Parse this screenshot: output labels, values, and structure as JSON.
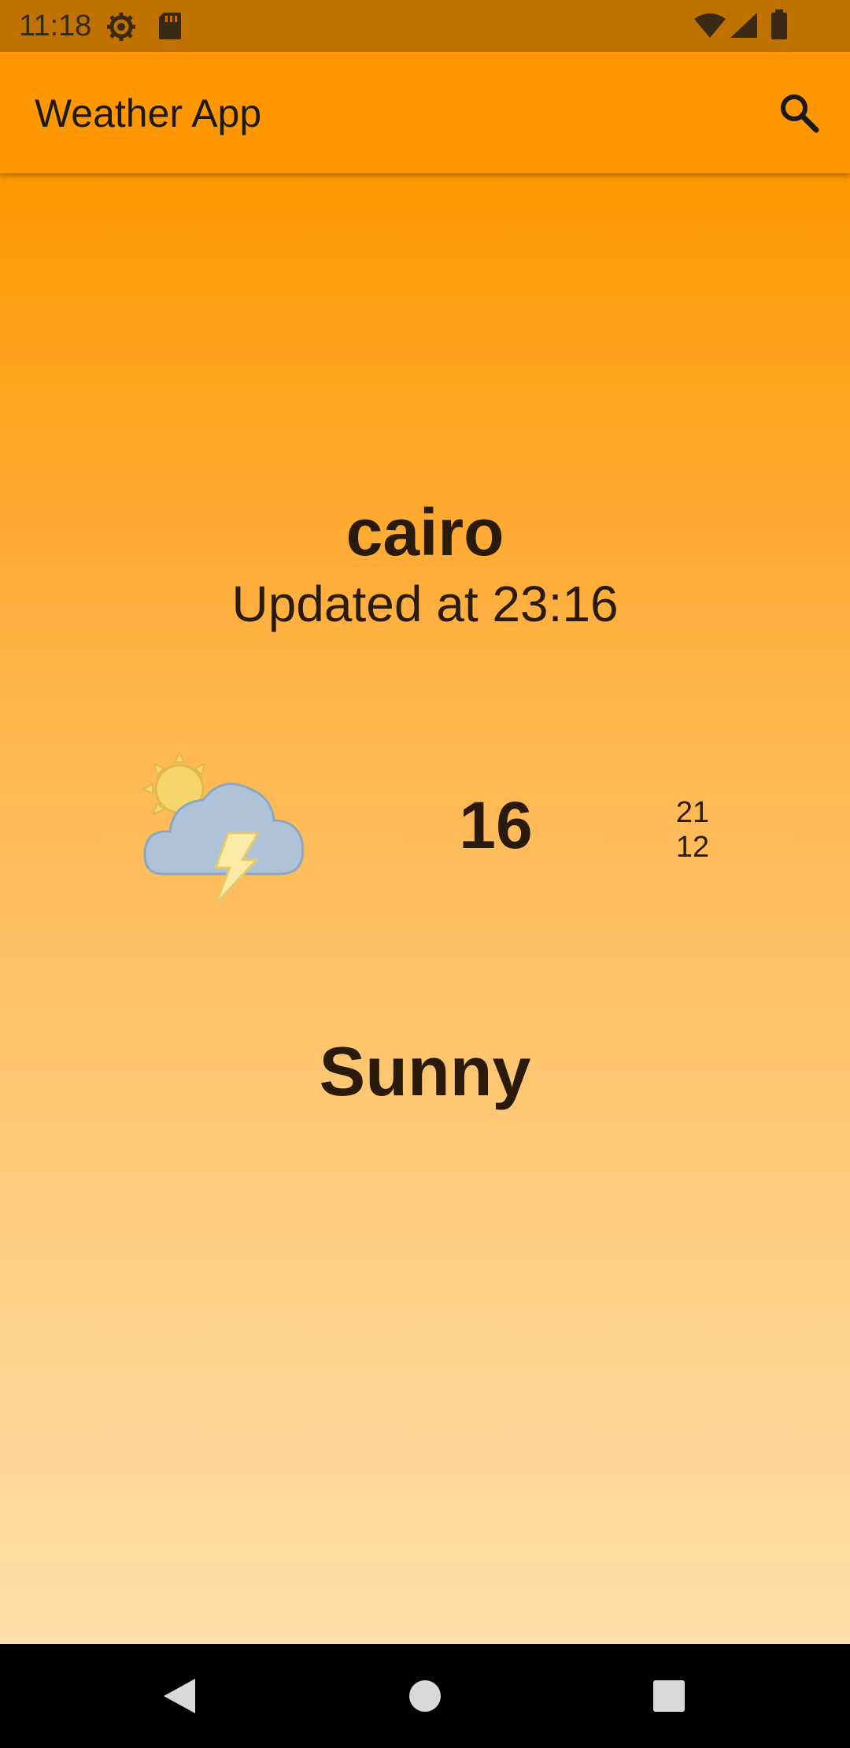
{
  "status_bar": {
    "time": "11:18",
    "icons": [
      "gear-icon",
      "sd-card-icon",
      "wifi-icon",
      "signal-icon",
      "battery-icon"
    ]
  },
  "app_bar": {
    "title": "Weather App",
    "search_icon": "search-icon"
  },
  "weather": {
    "city": "cairo",
    "updated": "Updated at 23:16",
    "icon": "partly-cloudy-thunderstorm-icon",
    "temperature": "16",
    "max": "21",
    "min": "12",
    "condition": "Sunny"
  },
  "nav_bar": {
    "buttons": [
      "back-icon",
      "home-icon",
      "recents-icon"
    ]
  },
  "colors": {
    "status_bar": "#BF7200",
    "app_bar": "#FF9800",
    "gradient_top": "#FF9800",
    "gradient_bottom": "#FFDFAA"
  }
}
